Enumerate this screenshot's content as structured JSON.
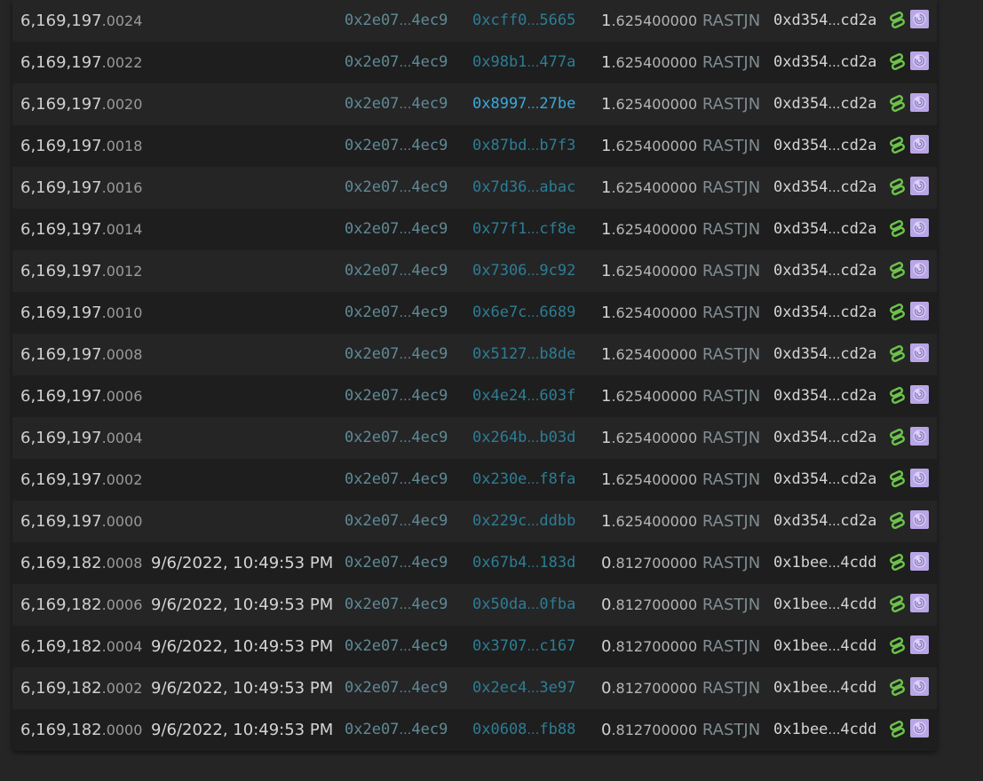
{
  "ellipsis": "…",
  "token_symbol": "RASTJN",
  "icons": {
    "link": "chain-link-icon",
    "link_color": "#6cc24a",
    "avatar": "spiral-avatar-icon",
    "avatar_color": "#b9a6e6"
  },
  "rows": [
    {
      "block_int": "6,169,197",
      "block_frac": ".0024",
      "time": "",
      "from_head": "0x2e07",
      "from_tail": "4ec9",
      "to_head": "0xcff0",
      "to_tail": "5665",
      "amount_int": "1",
      "amount_dec": ".625400000",
      "owner_head": "0xd354",
      "owner_tail": "cd2a",
      "highlight": false
    },
    {
      "block_int": "6,169,197",
      "block_frac": ".0022",
      "time": "",
      "from_head": "0x2e07",
      "from_tail": "4ec9",
      "to_head": "0x98b1",
      "to_tail": "477a",
      "amount_int": "1",
      "amount_dec": ".625400000",
      "owner_head": "0xd354",
      "owner_tail": "cd2a",
      "highlight": false
    },
    {
      "block_int": "6,169,197",
      "block_frac": ".0020",
      "time": "",
      "from_head": "0x2e07",
      "from_tail": "4ec9",
      "to_head": "0x8997",
      "to_tail": "27be",
      "amount_int": "1",
      "amount_dec": ".625400000",
      "owner_head": "0xd354",
      "owner_tail": "cd2a",
      "highlight": true
    },
    {
      "block_int": "6,169,197",
      "block_frac": ".0018",
      "time": "",
      "from_head": "0x2e07",
      "from_tail": "4ec9",
      "to_head": "0x87bd",
      "to_tail": "b7f3",
      "amount_int": "1",
      "amount_dec": ".625400000",
      "owner_head": "0xd354",
      "owner_tail": "cd2a",
      "highlight": false
    },
    {
      "block_int": "6,169,197",
      "block_frac": ".0016",
      "time": "",
      "from_head": "0x2e07",
      "from_tail": "4ec9",
      "to_head": "0x7d36",
      "to_tail": "abac",
      "amount_int": "1",
      "amount_dec": ".625400000",
      "owner_head": "0xd354",
      "owner_tail": "cd2a",
      "highlight": false
    },
    {
      "block_int": "6,169,197",
      "block_frac": ".0014",
      "time": "",
      "from_head": "0x2e07",
      "from_tail": "4ec9",
      "to_head": "0x77f1",
      "to_tail": "cf8e",
      "amount_int": "1",
      "amount_dec": ".625400000",
      "owner_head": "0xd354",
      "owner_tail": "cd2a",
      "highlight": false
    },
    {
      "block_int": "6,169,197",
      "block_frac": ".0012",
      "time": "",
      "from_head": "0x2e07",
      "from_tail": "4ec9",
      "to_head": "0x7306",
      "to_tail": "9c92",
      "amount_int": "1",
      "amount_dec": ".625400000",
      "owner_head": "0xd354",
      "owner_tail": "cd2a",
      "highlight": false
    },
    {
      "block_int": "6,169,197",
      "block_frac": ".0010",
      "time": "",
      "from_head": "0x2e07",
      "from_tail": "4ec9",
      "to_head": "0x6e7c",
      "to_tail": "6689",
      "amount_int": "1",
      "amount_dec": ".625400000",
      "owner_head": "0xd354",
      "owner_tail": "cd2a",
      "highlight": false
    },
    {
      "block_int": "6,169,197",
      "block_frac": ".0008",
      "time": "",
      "from_head": "0x2e07",
      "from_tail": "4ec9",
      "to_head": "0x5127",
      "to_tail": "b8de",
      "amount_int": "1",
      "amount_dec": ".625400000",
      "owner_head": "0xd354",
      "owner_tail": "cd2a",
      "highlight": false
    },
    {
      "block_int": "6,169,197",
      "block_frac": ".0006",
      "time": "",
      "from_head": "0x2e07",
      "from_tail": "4ec9",
      "to_head": "0x4e24",
      "to_tail": "603f",
      "amount_int": "1",
      "amount_dec": ".625400000",
      "owner_head": "0xd354",
      "owner_tail": "cd2a",
      "highlight": false
    },
    {
      "block_int": "6,169,197",
      "block_frac": ".0004",
      "time": "",
      "from_head": "0x2e07",
      "from_tail": "4ec9",
      "to_head": "0x264b",
      "to_tail": "b03d",
      "amount_int": "1",
      "amount_dec": ".625400000",
      "owner_head": "0xd354",
      "owner_tail": "cd2a",
      "highlight": false
    },
    {
      "block_int": "6,169,197",
      "block_frac": ".0002",
      "time": "",
      "from_head": "0x2e07",
      "from_tail": "4ec9",
      "to_head": "0x230e",
      "to_tail": "f8fa",
      "amount_int": "1",
      "amount_dec": ".625400000",
      "owner_head": "0xd354",
      "owner_tail": "cd2a",
      "highlight": false
    },
    {
      "block_int": "6,169,197",
      "block_frac": ".0000",
      "time": "",
      "from_head": "0x2e07",
      "from_tail": "4ec9",
      "to_head": "0x229c",
      "to_tail": "ddbb",
      "amount_int": "1",
      "amount_dec": ".625400000",
      "owner_head": "0xd354",
      "owner_tail": "cd2a",
      "highlight": false
    },
    {
      "block_int": "6,169,182",
      "block_frac": ".0008",
      "time": "9/6/2022, 10:49:53 PM",
      "from_head": "0x2e07",
      "from_tail": "4ec9",
      "to_head": "0x67b4",
      "to_tail": "183d",
      "amount_int": "0",
      "amount_dec": ".812700000",
      "owner_head": "0x1bee",
      "owner_tail": "4cdd",
      "highlight": false
    },
    {
      "block_int": "6,169,182",
      "block_frac": ".0006",
      "time": "9/6/2022, 10:49:53 PM",
      "from_head": "0x2e07",
      "from_tail": "4ec9",
      "to_head": "0x50da",
      "to_tail": "0fba",
      "amount_int": "0",
      "amount_dec": ".812700000",
      "owner_head": "0x1bee",
      "owner_tail": "4cdd",
      "highlight": false
    },
    {
      "block_int": "6,169,182",
      "block_frac": ".0004",
      "time": "9/6/2022, 10:49:53 PM",
      "from_head": "0x2e07",
      "from_tail": "4ec9",
      "to_head": "0x3707",
      "to_tail": "c167",
      "amount_int": "0",
      "amount_dec": ".812700000",
      "owner_head": "0x1bee",
      "owner_tail": "4cdd",
      "highlight": false
    },
    {
      "block_int": "6,169,182",
      "block_frac": ".0002",
      "time": "9/6/2022, 10:49:53 PM",
      "from_head": "0x2e07",
      "from_tail": "4ec9",
      "to_head": "0x2ec4",
      "to_tail": "3e97",
      "amount_int": "0",
      "amount_dec": ".812700000",
      "owner_head": "0x1bee",
      "owner_tail": "4cdd",
      "highlight": false
    },
    {
      "block_int": "6,169,182",
      "block_frac": ".0000",
      "time": "9/6/2022, 10:49:53 PM",
      "from_head": "0x2e07",
      "from_tail": "4ec9",
      "to_head": "0x0608",
      "to_tail": "fb88",
      "amount_int": "0",
      "amount_dec": ".812700000",
      "owner_head": "0x1bee",
      "owner_tail": "4cdd",
      "highlight": false
    }
  ]
}
